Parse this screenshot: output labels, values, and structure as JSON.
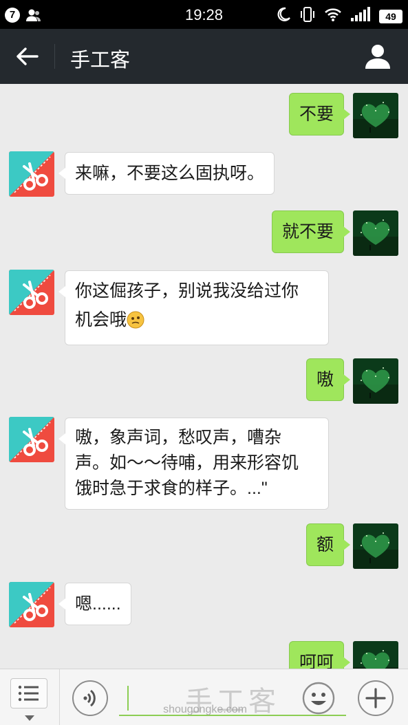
{
  "status_bar": {
    "notification_count": "7",
    "time": "19:28",
    "battery": "49"
  },
  "header": {
    "title": "手工客"
  },
  "messages": [
    {
      "side": "sent",
      "text": "不要"
    },
    {
      "side": "received",
      "text": "来嘛，不要这么固执呀。"
    },
    {
      "side": "sent",
      "text": "就不要"
    },
    {
      "side": "received",
      "lines": [
        "你这倔孩子，别说我没给过你",
        "机会哦"
      ],
      "emoji": "thinking-face"
    },
    {
      "side": "sent",
      "text": "嗷"
    },
    {
      "side": "received",
      "lines": [
        "嗷，象声词，愁叹声，嘈杂",
        "声。如～～待哺，用来形容饥",
        "饿时急于求食的样子。...\""
      ]
    },
    {
      "side": "sent",
      "text": "额"
    },
    {
      "side": "received",
      "text": "嗯......"
    },
    {
      "side": "sent",
      "text": "呵呵"
    }
  ],
  "input_bar": {
    "watermark_title": "手工客",
    "watermark_url": "shougongke.com"
  },
  "colors": {
    "sent_bubble": "#9fe65c",
    "received_bubble": "#ffffff",
    "header_bg": "#24292e",
    "chat_bg": "#ebebeb",
    "brand_avatar_red": "#ef4b3f",
    "brand_avatar_teal": "#3cc9c4"
  },
  "icons": {
    "back": "arrow-left-icon",
    "profile": "person-icon",
    "menu": "list-icon",
    "voice": "voice-icon",
    "emoji": "smiley-icon",
    "add": "plus-icon"
  }
}
